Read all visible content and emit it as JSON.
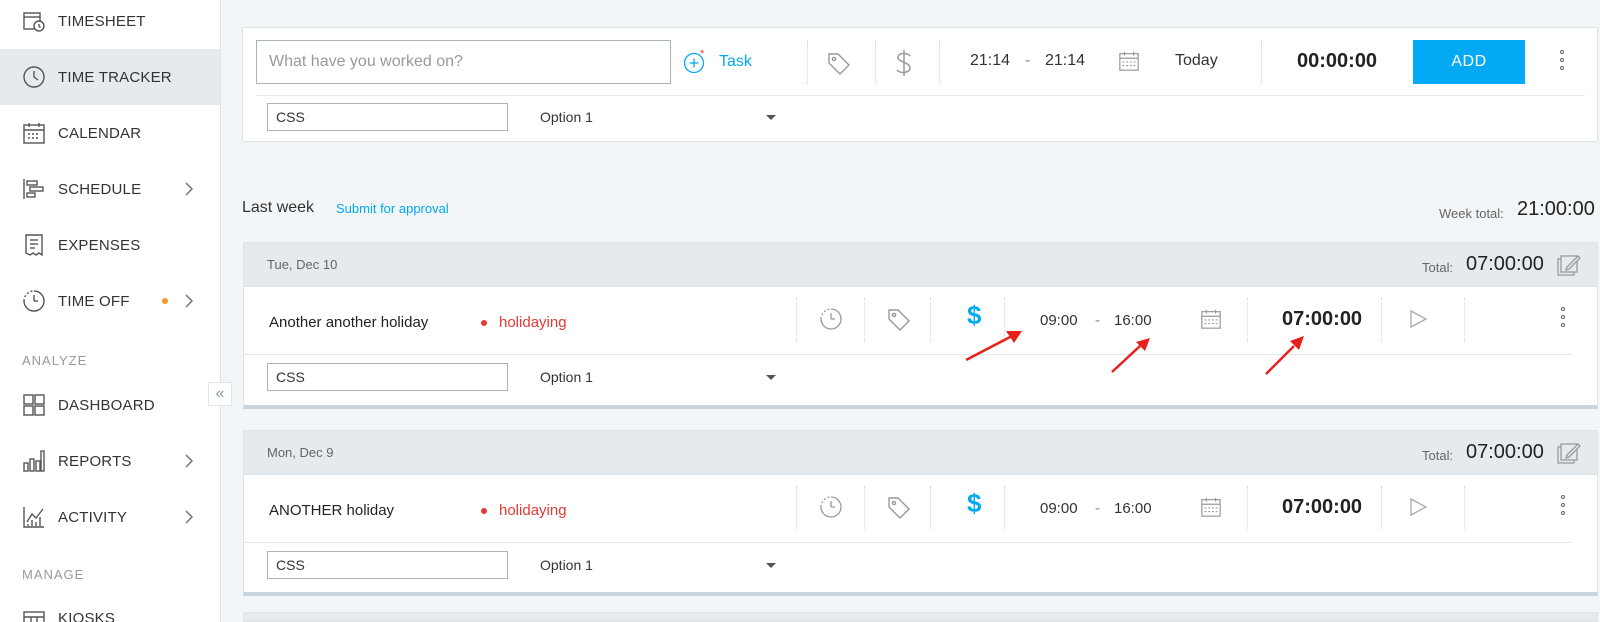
{
  "sidebar": {
    "items": [
      {
        "label": "TIMESHEET"
      },
      {
        "label": "TIME TRACKER"
      },
      {
        "label": "CALENDAR"
      },
      {
        "label": "SCHEDULE"
      },
      {
        "label": "EXPENSES"
      },
      {
        "label": "TIME OFF"
      },
      {
        "label": "DASHBOARD"
      },
      {
        "label": "REPORTS"
      },
      {
        "label": "ACTIVITY"
      },
      {
        "label": "KIOSKS"
      }
    ],
    "section_analyze": "ANALYZE",
    "section_manage": "MANAGE",
    "collapse_glyph": "«"
  },
  "entry_bar": {
    "placeholder": "What have you worked on?",
    "task_label": "Task",
    "start": "21:14",
    "dash": "-",
    "end": "21:14",
    "date": "Today",
    "duration": "00:00:00",
    "add_label": "ADD",
    "field_value": "CSS",
    "option": "Option 1"
  },
  "week": {
    "label": "Last week",
    "submit_label": "Submit for approval",
    "total_label": "Week total:",
    "total": "21:00:00"
  },
  "days": [
    {
      "date": "Tue, Dec 10",
      "total_label": "Total:",
      "total": "07:00:00",
      "entry": {
        "description": "Another another holiday",
        "project": "holidaying",
        "currency": "$",
        "start": "09:00",
        "dash": "-",
        "end": "16:00",
        "duration": "07:00:00",
        "field_value": "CSS",
        "option": "Option 1"
      }
    },
    {
      "date": "Mon, Dec 9",
      "total_label": "Total:",
      "total": "07:00:00",
      "entry": {
        "description": "ANOTHER holiday",
        "project": "holidaying",
        "currency": "$",
        "start": "09:00",
        "dash": "-",
        "end": "16:00",
        "duration": "07:00:00",
        "field_value": "CSS",
        "option": "Option 1"
      }
    }
  ],
  "colors": {
    "accent": "#03a9f4",
    "project": "#e53935",
    "annotation_arrow": "#e8201c",
    "time_off_dot": "#f6961e"
  }
}
